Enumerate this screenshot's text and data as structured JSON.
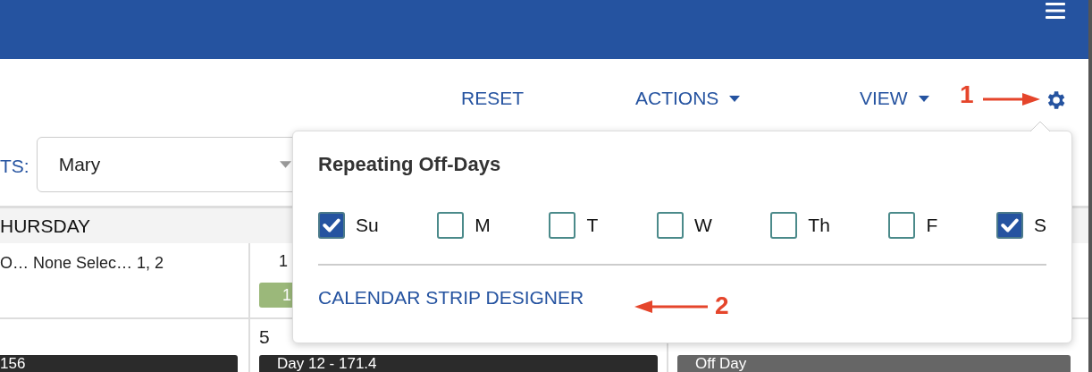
{
  "toolbar": {
    "buttons": [
      {
        "label": "RESET",
        "kind": "plain"
      },
      {
        "label": "ACTIONS",
        "kind": "dropdown"
      },
      {
        "label": "VIEW",
        "kind": "dropdown"
      }
    ]
  },
  "filter": {
    "label": "TS:",
    "value": "Mary"
  },
  "calendar": {
    "day_header": "HURSDAY",
    "rows": [
      {
        "cells": [
          {
            "text": "O… None Selec… 1, 2"
          },
          {
            "date": "1",
            "badge": {
              "text": "1",
              "color": "#9bb87a"
            }
          }
        ]
      },
      {
        "cells": [
          {
            "bar": {
              "text": "156",
              "kind": "dark"
            }
          },
          {
            "date": "5",
            "bar": {
              "text": "Day 12 - 171.4",
              "kind": "dark"
            }
          },
          {
            "bar": {
              "text": "Off Day",
              "kind": "grey"
            }
          }
        ]
      }
    ]
  },
  "popup": {
    "title": "Repeating Off-Days",
    "days": [
      {
        "label": "Su",
        "checked": true
      },
      {
        "label": "M",
        "checked": false
      },
      {
        "label": "T",
        "checked": false
      },
      {
        "label": "W",
        "checked": false
      },
      {
        "label": "Th",
        "checked": false
      },
      {
        "label": "F",
        "checked": false
      },
      {
        "label": "S",
        "checked": true
      }
    ],
    "link": "CALENDAR STRIP DESIGNER"
  },
  "annotations": [
    {
      "text": "1"
    },
    {
      "text": "2"
    }
  ]
}
